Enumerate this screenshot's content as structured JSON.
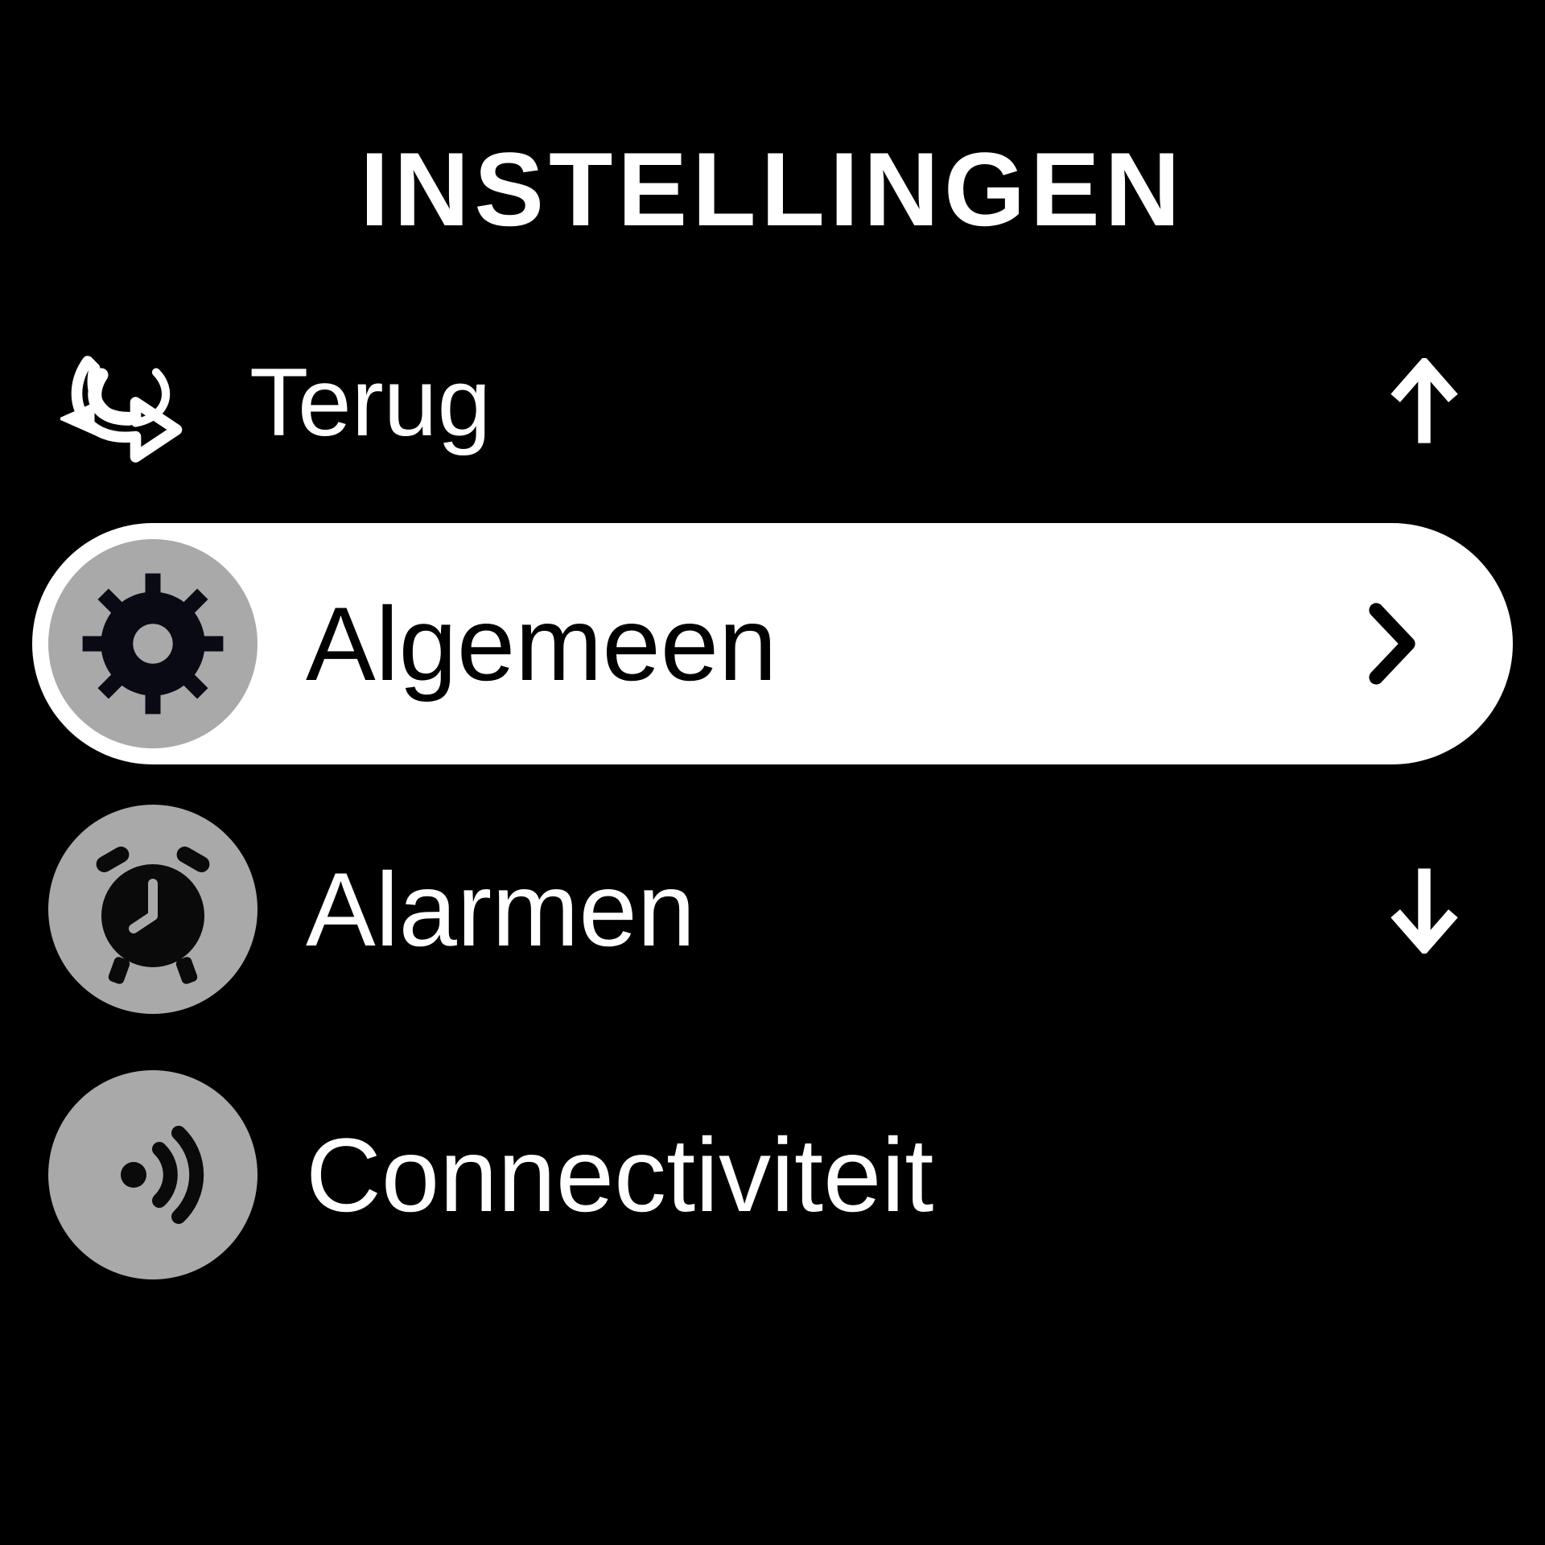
{
  "header": {
    "title": "INSTELLINGEN"
  },
  "menu": {
    "back": {
      "label": "Terug",
      "icon": "back-arrow-icon"
    },
    "items": [
      {
        "label": "Algemeen",
        "icon": "gear-icon",
        "selected": true
      },
      {
        "label": "Alarmen",
        "icon": "alarm-clock-icon",
        "selected": false
      },
      {
        "label": "Connectiviteit",
        "icon": "connectivity-icon",
        "selected": false
      }
    ]
  },
  "scroll": {
    "up": "↑",
    "down": "↓",
    "chevron": "›"
  }
}
